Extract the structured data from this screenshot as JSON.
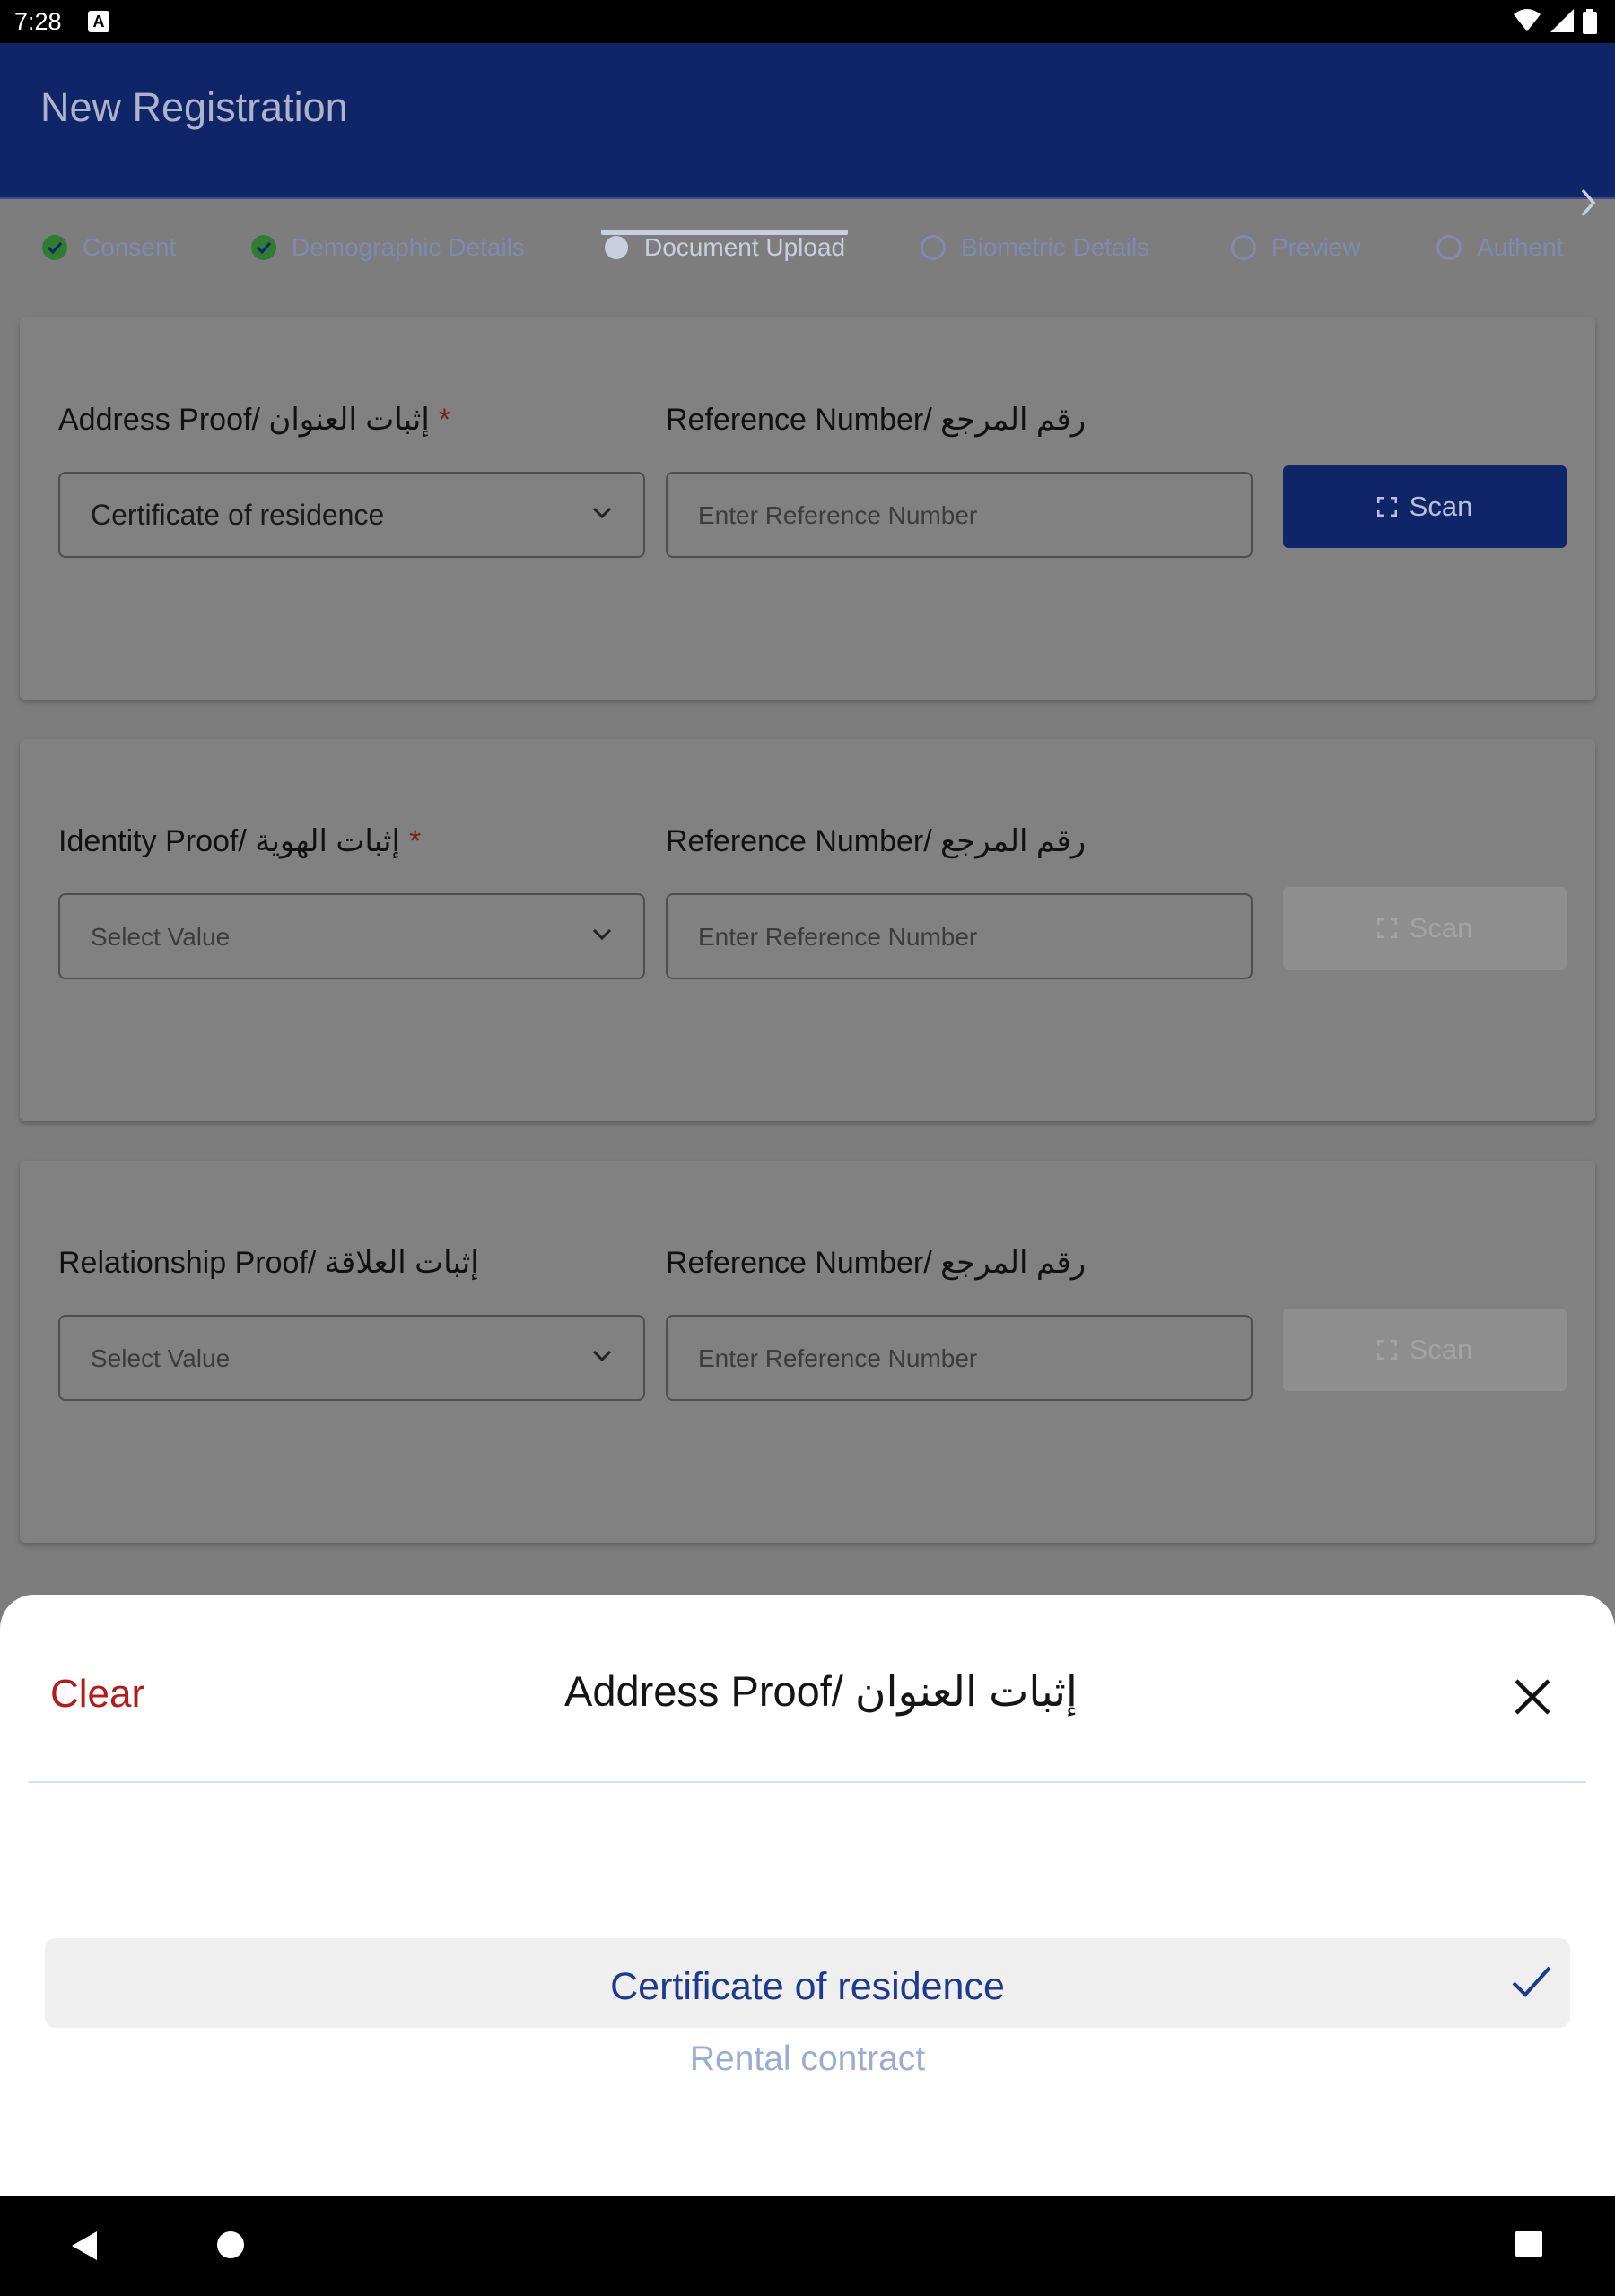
{
  "status_bar": {
    "time": "7:28",
    "notification_badge": "A"
  },
  "header": {
    "title": "New Registration"
  },
  "tabs": [
    {
      "label": "Consent",
      "state": "done"
    },
    {
      "label": "Demographic Details",
      "state": "done"
    },
    {
      "label": "Document Upload",
      "state": "active"
    },
    {
      "label": "Biometric Details",
      "state": "pending"
    },
    {
      "label": "Preview",
      "state": "pending"
    },
    {
      "label": "Authent",
      "state": "pending"
    }
  ],
  "documents": [
    {
      "label": "Address Proof/ إثبات العنوان",
      "required": "*",
      "selected_value": "Certificate of residence",
      "ref_label": "Reference Number/ رقم المرجع",
      "ref_placeholder": "Enter Reference Number",
      "scan_label": "Scan",
      "scan_enabled": true
    },
    {
      "label": "Identity Proof/ إثبات الهوية",
      "required": "*",
      "placeholder": "Select Value",
      "ref_label": "Reference Number/ رقم المرجع",
      "ref_placeholder": "Enter Reference Number",
      "scan_label": "Scan",
      "scan_enabled": false
    },
    {
      "label": "Relationship Proof/ إثبات العلاقة",
      "placeholder": "Select Value",
      "ref_label": "Reference Number/ رقم المرجع",
      "ref_placeholder": "Enter Reference Number",
      "scan_label": "Scan",
      "scan_enabled": false
    }
  ],
  "sheet": {
    "clear_label": "Clear",
    "title": "Address Proof/ إثبات العنوان",
    "options": [
      {
        "label": "Certificate of residence",
        "selected": true
      },
      {
        "label": "Rental contract",
        "selected": false
      }
    ]
  },
  "colors": {
    "primary": "#0f2568",
    "done_green": "#2e8b3a",
    "clear_red": "#b41c1c",
    "selected_blue": "#1c3a8f"
  }
}
